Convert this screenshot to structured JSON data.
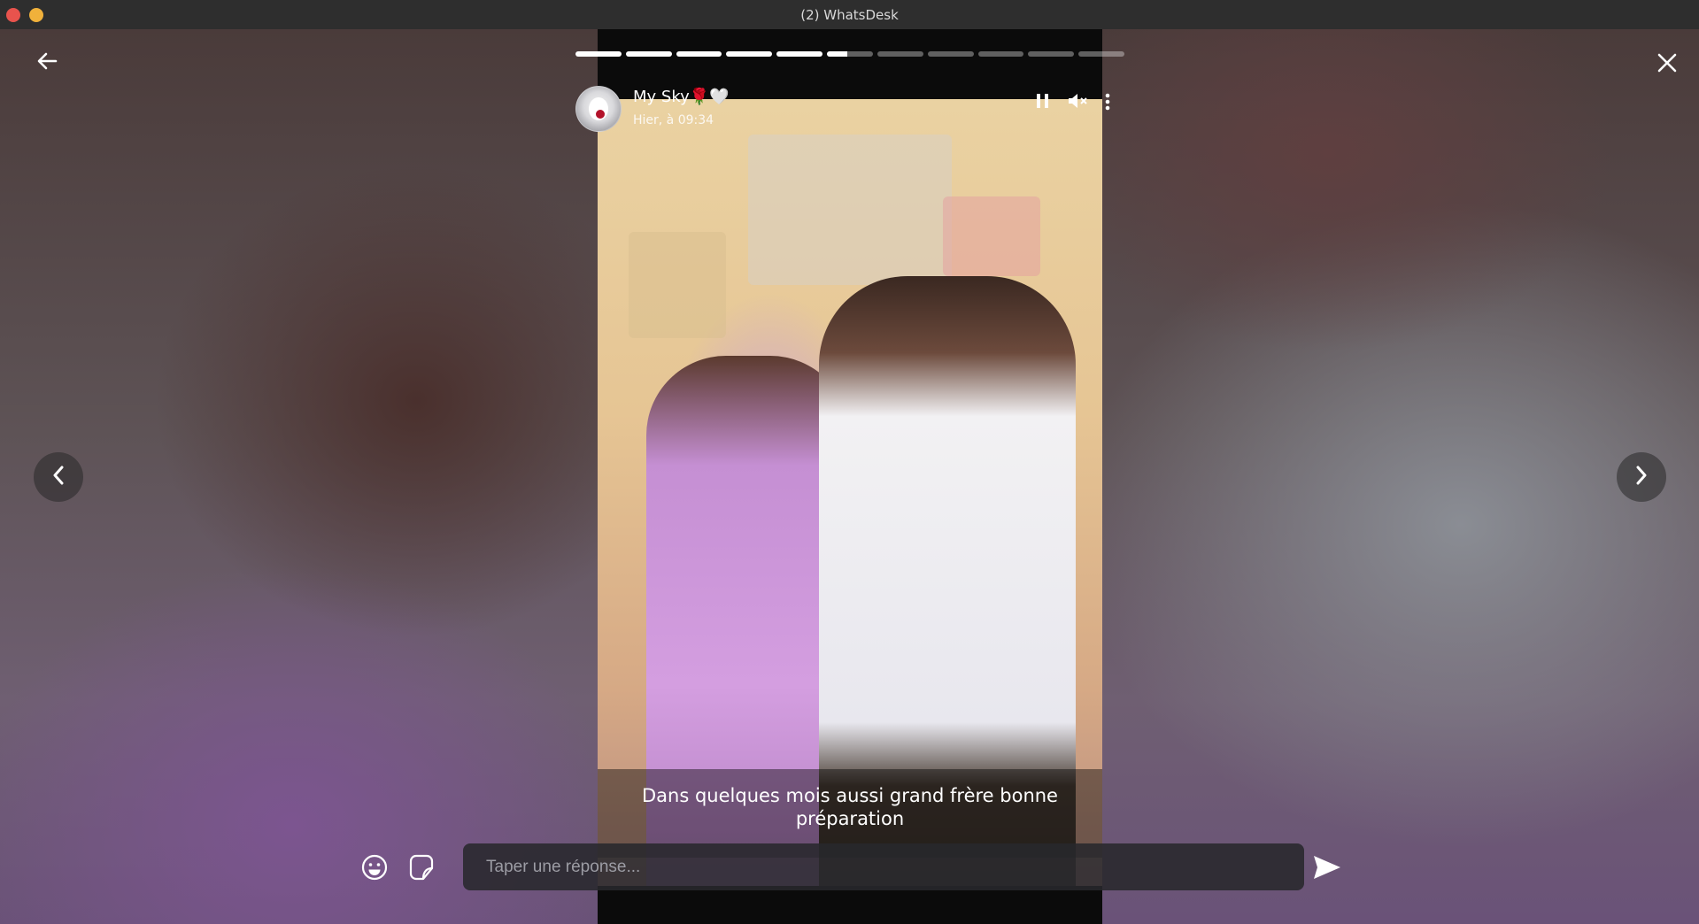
{
  "window": {
    "title": "(2) WhatsDesk"
  },
  "story": {
    "contact_name": "My Sky🌹🤍",
    "timestamp": "Hier, à 09:34",
    "caption": "Dans quelques mois aussi grand frère bonne préparation",
    "progress": [
      1,
      1,
      1,
      1,
      1,
      0.45,
      0,
      0,
      0,
      0,
      0
    ]
  },
  "reply": {
    "placeholder": "Taper une réponse..."
  },
  "icons": {
    "back": "back-arrow-icon",
    "close": "close-icon",
    "pause": "pause-icon",
    "mute": "muted-speaker-icon",
    "menu": "more-vertical-icon",
    "prev": "chevron-left-icon",
    "next": "chevron-right-icon",
    "emoji": "emoji-icon",
    "sticker": "sticker-icon",
    "send": "send-icon"
  },
  "colors": {
    "accent": "#ffffff",
    "progress_track": "#ffffff59"
  }
}
